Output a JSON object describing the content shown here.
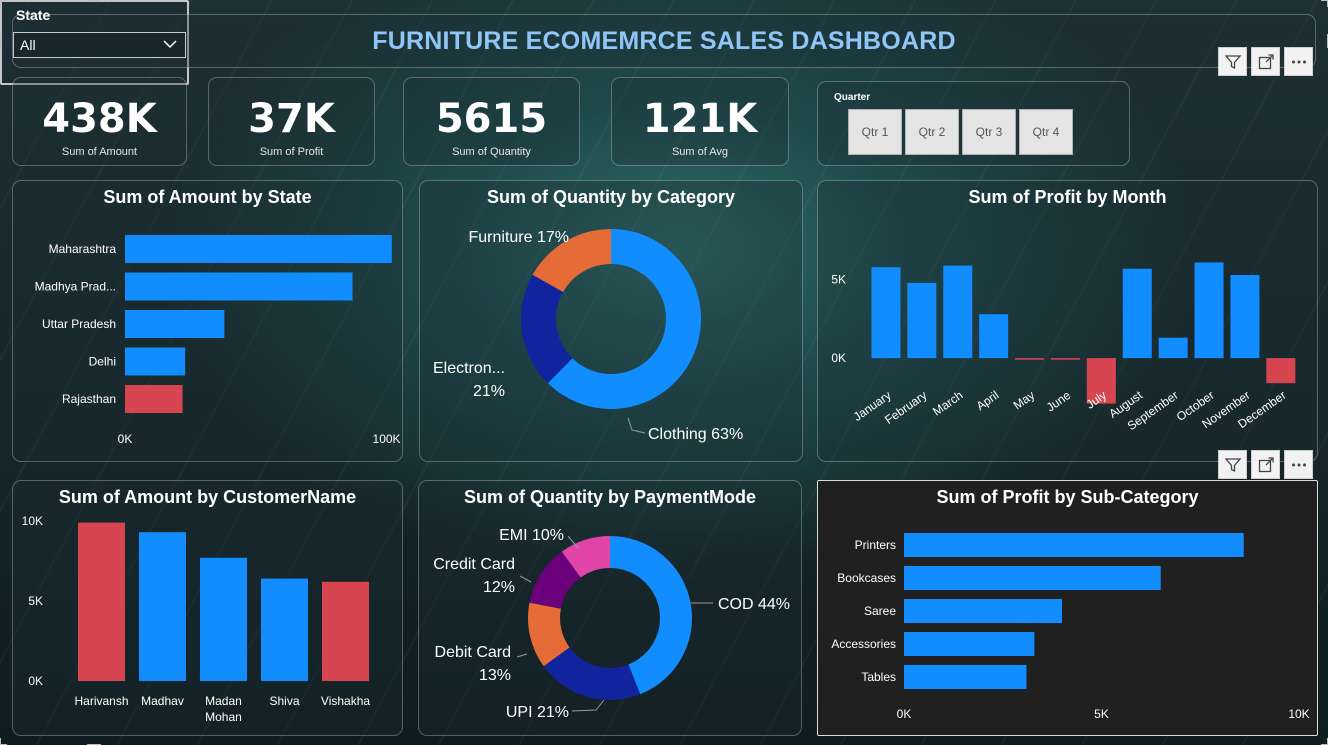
{
  "header": {
    "title": "FURNITURE ECOMEMRCE SALES DASHBOARD"
  },
  "kpis": [
    {
      "value": "438K",
      "label": "Sum of Amount"
    },
    {
      "value": "37K",
      "label": "Sum of Profit"
    },
    {
      "value": "5615",
      "label": "Sum of Quantity"
    },
    {
      "value": "121K",
      "label": "Sum of Avg"
    }
  ],
  "quarter_slicer": {
    "title": "Quarter",
    "options": [
      "Qtr 1",
      "Qtr 2",
      "Qtr 3",
      "Qtr 4"
    ]
  },
  "state_slicer": {
    "title": "State",
    "selected": "All"
  },
  "colors": {
    "positive": "#118dff",
    "negative": "#d64550",
    "furniture": "#e66c37",
    "electronics": "#12239e",
    "emi": "#e044a7",
    "credit_card": "#6b007b",
    "debit_card": "#e66c37",
    "upi": "#12239e",
    "cod": "#118dff"
  },
  "icons": [
    "filter-icon",
    "focus-mode-icon",
    "more-options-icon",
    "chevron-down-icon"
  ],
  "chart_data": [
    {
      "id": "amount_by_state",
      "type": "bar",
      "orientation": "horizontal",
      "title": "Sum of Amount by State",
      "categories": [
        "Maharashtra",
        "Madhya Prad...",
        "Uttar Pradesh",
        "Delhi",
        "Rajasthan"
      ],
      "values": [
        102000,
        87000,
        38000,
        23000,
        22000
      ],
      "highlight": [
        false,
        false,
        false,
        false,
        true
      ],
      "xlim": [
        0,
        130000
      ],
      "ticks": [
        {
          "value": 0,
          "label": "0K"
        },
        {
          "value": 100000,
          "label": "100K"
        }
      ]
    },
    {
      "id": "quantity_by_category",
      "type": "pie",
      "donut": true,
      "title": "Sum of Quantity by Category",
      "slices": [
        {
          "name": "Clothing",
          "value": 63,
          "label": "Clothing 63%",
          "color": "#118dff"
        },
        {
          "name": "Electronics",
          "value": 21,
          "label_lines": [
            "Electron...",
            "21%"
          ],
          "color": "#12239e"
        },
        {
          "name": "Furniture",
          "value": 17,
          "label": "Furniture 17%",
          "color": "#e66c37"
        }
      ]
    },
    {
      "id": "profit_by_month",
      "type": "bar",
      "orientation": "vertical",
      "title": "Sum of Profit by Month",
      "categories": [
        "January",
        "February",
        "March",
        "April",
        "May",
        "June",
        "July",
        "August",
        "September",
        "October",
        "November",
        "December"
      ],
      "values": [
        5800,
        4800,
        5900,
        2800,
        -100,
        -100,
        -2900,
        5700,
        1300,
        6100,
        5300,
        -1600
      ],
      "ylim": [
        -3500,
        9000
      ],
      "ticks": [
        {
          "value": 0,
          "label": "0K"
        },
        {
          "value": 5000,
          "label": "5K"
        }
      ]
    },
    {
      "id": "amount_by_customer",
      "type": "bar",
      "orientation": "vertical",
      "title": "Sum of Amount by CustomerName",
      "categories": [
        [
          "Harivansh"
        ],
        [
          "Madhav"
        ],
        [
          "Madan",
          "Mohan"
        ],
        [
          "Shiva"
        ],
        [
          "Vishakha"
        ]
      ],
      "values": [
        9900,
        9300,
        7700,
        6400,
        6200
      ],
      "highlight": [
        true,
        false,
        false,
        false,
        true
      ],
      "ylim": [
        0,
        10000
      ],
      "ticks": [
        {
          "value": 0,
          "label": "0K"
        },
        {
          "value": 5000,
          "label": "5K"
        },
        {
          "value": 10000,
          "label": "10K"
        }
      ]
    },
    {
      "id": "quantity_by_paymentmode",
      "type": "pie",
      "donut": true,
      "title": "Sum of Quantity by PaymentMode",
      "slices": [
        {
          "name": "COD",
          "value": 44,
          "label": "COD 44%",
          "color": "#118dff"
        },
        {
          "name": "UPI",
          "value": 21,
          "label": "UPI 21%",
          "color": "#12239e"
        },
        {
          "name": "Debit Card",
          "value": 13,
          "label_lines": [
            "Debit Card",
            "13%"
          ],
          "color": "#e66c37"
        },
        {
          "name": "Credit Card",
          "value": 12,
          "label_lines": [
            "Credit Card",
            "12%"
          ],
          "color": "#6b007b"
        },
        {
          "name": "EMI",
          "value": 10,
          "label": "EMI 10%",
          "color": "#e044a7"
        }
      ]
    },
    {
      "id": "profit_by_subcategory",
      "type": "bar",
      "orientation": "horizontal",
      "title": "Sum of Profit by Sub-Category",
      "categories": [
        "Printers",
        "Bookcases",
        "Saree",
        "Accessories",
        "Tables"
      ],
      "values": [
        8600,
        6500,
        4000,
        3300,
        3100
      ],
      "xlim": [
        0,
        10000
      ],
      "ticks": [
        {
          "value": 0,
          "label": "0K"
        },
        {
          "value": 5000,
          "label": "5K"
        },
        {
          "value": 10000,
          "label": "10K"
        }
      ]
    }
  ]
}
